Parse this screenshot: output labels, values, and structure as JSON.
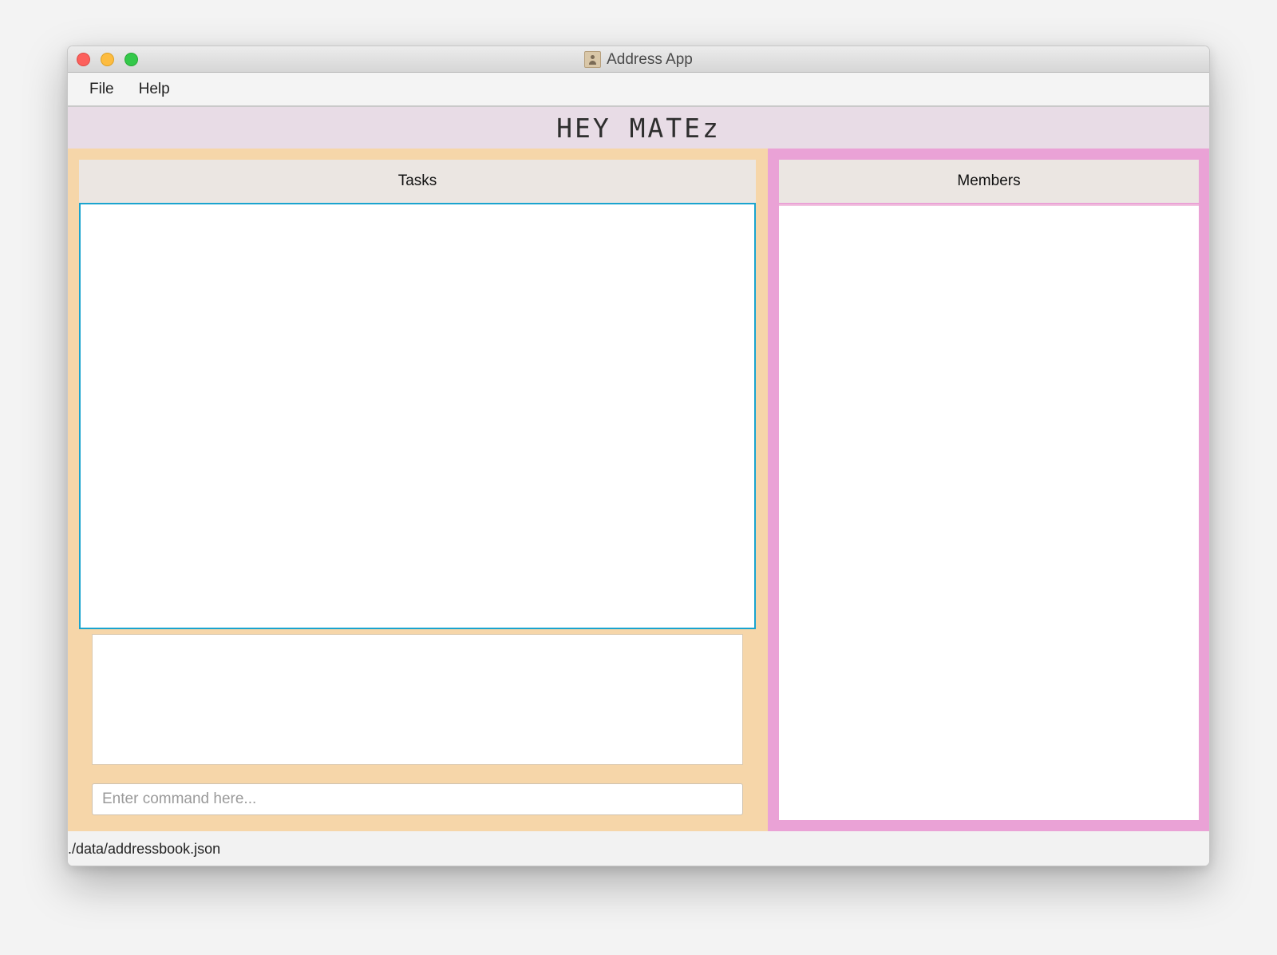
{
  "window": {
    "title": "Address App"
  },
  "menu": {
    "file_label": "File",
    "help_label": "Help"
  },
  "header": {
    "title": "HEY MATEz"
  },
  "tasks": {
    "label": "Tasks"
  },
  "command": {
    "placeholder": "Enter command here...",
    "value": ""
  },
  "members": {
    "label": "Members"
  },
  "status": {
    "file_path": "./data/addressbook.json"
  },
  "colors": {
    "accent": "#1aa4cf",
    "left_pane": "#f6d6a9",
    "right_pane": "#eaa2d6",
    "header_band": "#e8dce6"
  }
}
